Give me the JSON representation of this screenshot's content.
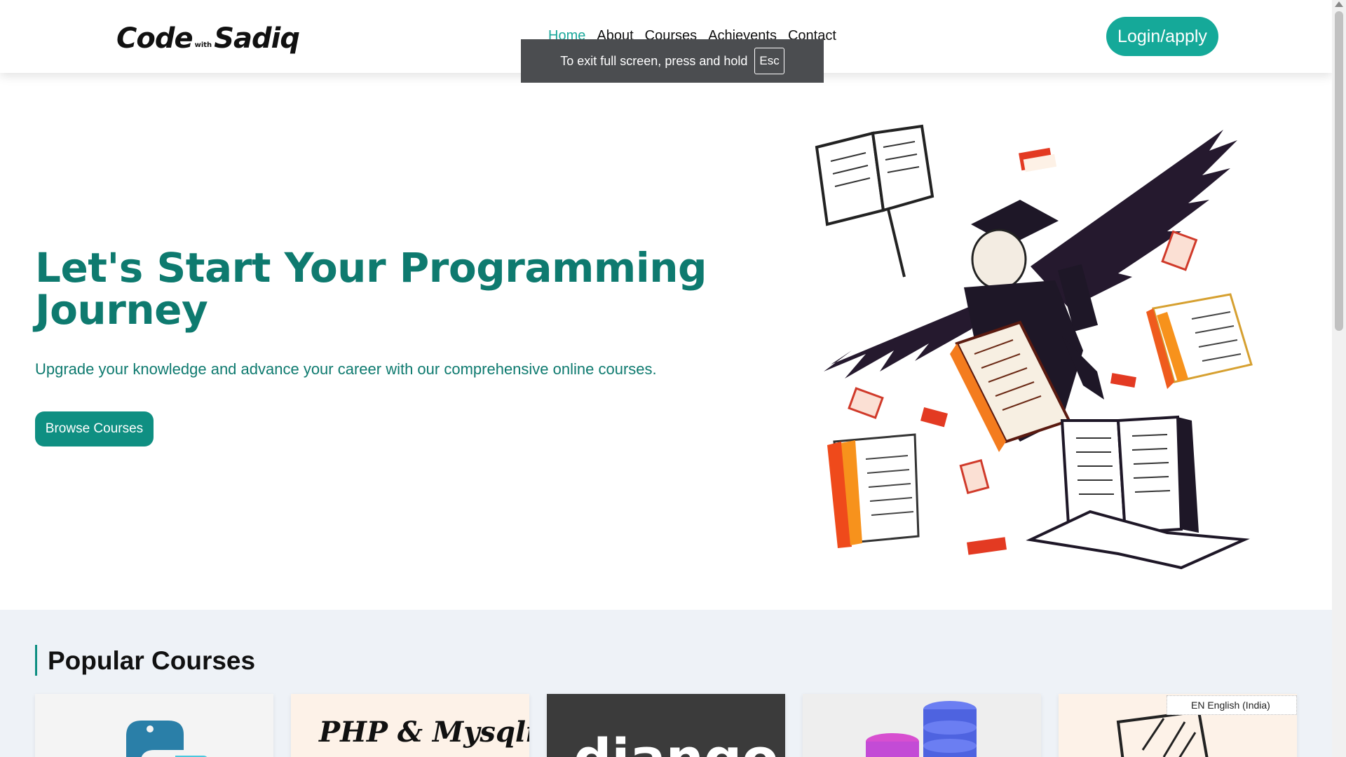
{
  "header": {
    "logo": {
      "code": "Code",
      "with": "with",
      "sadiq": "Sadiq"
    },
    "nav": [
      {
        "label": "Home",
        "active": true
      },
      {
        "label": "About",
        "active": false
      },
      {
        "label": "Courses",
        "active": false
      },
      {
        "label": "Achievents",
        "active": false
      },
      {
        "label": "Contact",
        "active": false
      }
    ],
    "login_label": "Login/apply"
  },
  "fullscreen_toast": {
    "text": "To exit full screen, press and hold",
    "key": "Esc"
  },
  "hero": {
    "title": "Let's Start Your Programming Journey",
    "subtitle": "Upgrade your knowledge and advance your career with our comprehensive online courses.",
    "button_label": "Browse Courses"
  },
  "popular": {
    "heading": "Popular Courses",
    "cards": [
      {
        "name": "python",
        "text": ""
      },
      {
        "name": "php-mysqli",
        "text": "PHP & Mysqli"
      },
      {
        "name": "django",
        "text": "django"
      },
      {
        "name": "database",
        "text": ""
      },
      {
        "name": "design",
        "text": ""
      }
    ]
  },
  "language_tooltip": "EN English (India)",
  "colors": {
    "accent": "#15a999",
    "hero_text": "#0e7a6f",
    "section_bg": "#eef2f7"
  }
}
